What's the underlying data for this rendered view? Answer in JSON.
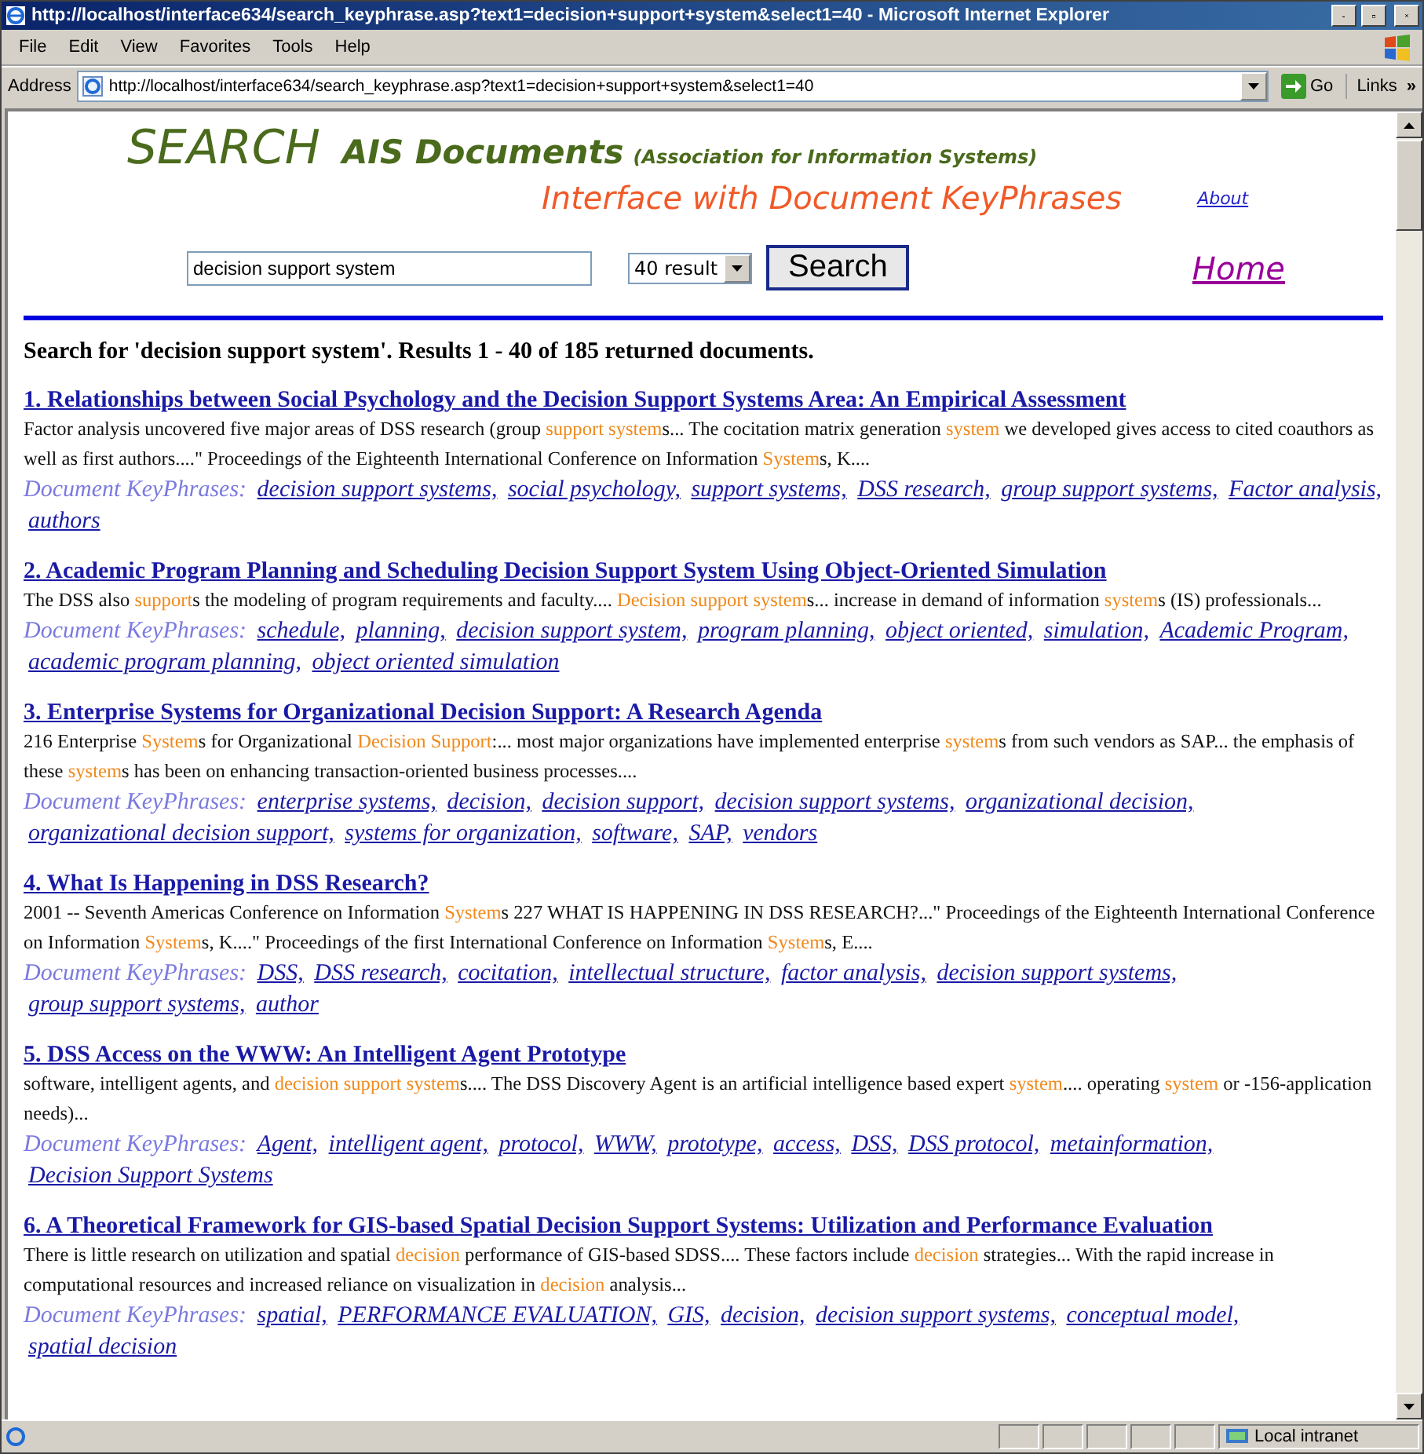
{
  "window": {
    "title": "http://localhost/interface634/search_keyphrase.asp?text1=decision+support+system&select1=40 - Microsoft Internet Explorer"
  },
  "menu": [
    "File",
    "Edit",
    "View",
    "Favorites",
    "Tools",
    "Help"
  ],
  "address_bar": {
    "label": "Address",
    "url": "http://localhost/interface634/search_keyphrase.asp?text1=decision+support+system&select1=40",
    "go": "Go",
    "links": "Links",
    "more": "»"
  },
  "header": {
    "logo": "SEARCH",
    "site": "AIS Documents",
    "site_note": "(Association for Information Systems)",
    "subtitle": "Interface with Document KeyPhrases",
    "about": "About",
    "query": "decision support system",
    "result_count": "40 result",
    "search_button": "Search",
    "home": "Home"
  },
  "summary": "Search for 'decision support system'. Results 1 - 40 of 185 returned documents.",
  "results": [
    {
      "title": "1. Relationships between Social Psychology and the Decision Support Systems Area: An Empirical Assessment",
      "snippet": [
        {
          "text": "Factor analysis uncovered five major areas of DSS research (group ",
          "highlight": false
        },
        {
          "text": "support system",
          "highlight": true
        },
        {
          "text": "s... The cocitation matrix generation ",
          "highlight": false
        },
        {
          "text": "system",
          "highlight": true
        },
        {
          "text": " we developed gives access to cited coauthors as well as first authors....\" Proceedings of the Eighteenth International Conference on Information ",
          "highlight": false
        },
        {
          "text": "System",
          "highlight": true
        },
        {
          "text": "s, K....",
          "highlight": false
        }
      ],
      "keyphrase_label": "Document KeyPhrases:",
      "keyphrases": [
        "decision support systems,",
        "social psychology,",
        "support systems,",
        "DSS research,",
        "group support systems,",
        "Factor analysis,",
        "authors"
      ]
    },
    {
      "title": "2. Academic Program Planning and Scheduling Decision Support System Using Object-Oriented Simulation",
      "snippet": [
        {
          "text": "The DSS also ",
          "highlight": false
        },
        {
          "text": "support",
          "highlight": true
        },
        {
          "text": "s the modeling of program requirements and faculty.... ",
          "highlight": false
        },
        {
          "text": "Decision support system",
          "highlight": true
        },
        {
          "text": "s... increase in demand of information ",
          "highlight": false
        },
        {
          "text": "system",
          "highlight": true
        },
        {
          "text": "s (IS) professionals...",
          "highlight": false
        }
      ],
      "keyphrase_label": "Document KeyPhrases:",
      "keyphrases": [
        "schedule,",
        "planning,",
        "decision support system,",
        "program planning,",
        "object oriented,",
        "simulation,",
        "Academic Program,",
        "academic program planning,",
        "object oriented simulation"
      ]
    },
    {
      "title": "3. Enterprise Systems for Organizational Decision Support: A Research Agenda",
      "snippet": [
        {
          "text": "216 Enterprise ",
          "highlight": false
        },
        {
          "text": "System",
          "highlight": true
        },
        {
          "text": "s for Organizational ",
          "highlight": false
        },
        {
          "text": "Decision Support",
          "highlight": true
        },
        {
          "text": ":... most major organizations have implemented enterprise ",
          "highlight": false
        },
        {
          "text": "system",
          "highlight": true
        },
        {
          "text": "s from such vendors as SAP... the emphasis of these ",
          "highlight": false
        },
        {
          "text": "system",
          "highlight": true
        },
        {
          "text": "s has been on enhancing transaction-oriented business processes....",
          "highlight": false
        }
      ],
      "keyphrase_label": "Document KeyPhrases:",
      "keyphrases": [
        "enterprise systems,",
        "decision,",
        "decision support,",
        "decision support systems,",
        "organizational decision,",
        "organizational decision support,",
        "systems for organization,",
        "software,",
        "SAP,",
        "vendors"
      ]
    },
    {
      "title": "4. What Is Happening in DSS Research?",
      "snippet": [
        {
          "text": "2001 -- Seventh Americas Conference on Information ",
          "highlight": false
        },
        {
          "text": "System",
          "highlight": true
        },
        {
          "text": "s 227 WHAT IS HAPPENING IN DSS RESEARCH?...\" Proceedings of the Eighteenth International Conference on Information ",
          "highlight": false
        },
        {
          "text": "System",
          "highlight": true
        },
        {
          "text": "s, K....\" Proceedings of the first International Conference on Information ",
          "highlight": false
        },
        {
          "text": "System",
          "highlight": true
        },
        {
          "text": "s, E....",
          "highlight": false
        }
      ],
      "keyphrase_label": "Document KeyPhrases:",
      "keyphrases": [
        "DSS,",
        "DSS research,",
        "cocitation,",
        "intellectual structure,",
        "factor analysis,",
        "decision support systems,",
        "group support systems,",
        "author"
      ]
    },
    {
      "title": "5. DSS Access on the WWW: An Intelligent Agent Prototype",
      "snippet": [
        {
          "text": "software, intelligent agents, and ",
          "highlight": false
        },
        {
          "text": "decision support system",
          "highlight": true
        },
        {
          "text": "s.... The DSS Discovery Agent is an artificial intelligence based expert ",
          "highlight": false
        },
        {
          "text": "system",
          "highlight": true
        },
        {
          "text": ".... operating ",
          "highlight": false
        },
        {
          "text": "system",
          "highlight": true
        },
        {
          "text": " or -156-application needs)...",
          "highlight": false
        }
      ],
      "keyphrase_label": "Document KeyPhrases:",
      "keyphrases": [
        "Agent,",
        "intelligent agent,",
        "protocol,",
        "WWW,",
        "prototype,",
        "access,",
        "DSS,",
        "DSS protocol,",
        "metainformation,",
        "Decision Support Systems"
      ]
    },
    {
      "title": "6. A Theoretical Framework for GIS-based Spatial Decision Support Systems: Utilization and Performance Evaluation",
      "snippet": [
        {
          "text": "There is little research on utilization and spatial ",
          "highlight": false
        },
        {
          "text": "decision",
          "highlight": true
        },
        {
          "text": " performance of GIS-based SDSS.... These factors include ",
          "highlight": false
        },
        {
          "text": "decision",
          "highlight": true
        },
        {
          "text": " strategies... With the rapid increase in computational resources and increased reliance on visualization in ",
          "highlight": false
        },
        {
          "text": "decision",
          "highlight": true
        },
        {
          "text": " analysis...",
          "highlight": false
        }
      ],
      "keyphrase_label": "Document KeyPhrases:",
      "keyphrases": [
        "spatial,",
        "PERFORMANCE EVALUATION,",
        "GIS,",
        "decision,",
        "decision support systems,",
        "conceptual model,",
        "spatial decision"
      ]
    }
  ],
  "status_bar": {
    "zone": "Local intranet"
  }
}
